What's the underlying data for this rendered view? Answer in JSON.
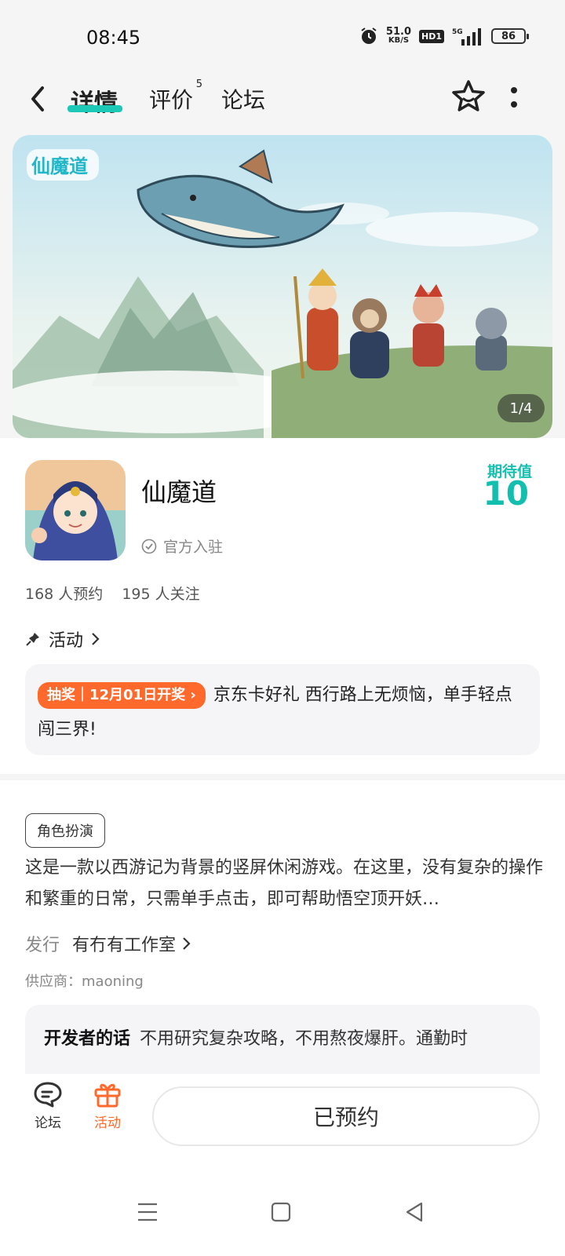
{
  "status": {
    "time": "08:45",
    "speed_value": "51.0",
    "speed_unit": "KB/S",
    "hd": "HD1",
    "network": "5G",
    "battery": "86"
  },
  "nav": {
    "tabs": [
      {
        "label": "详情"
      },
      {
        "label": "评价",
        "badge": "5"
      },
      {
        "label": "论坛"
      }
    ],
    "active_color": "#1ec8b6"
  },
  "banner": {
    "logo_text": "仙魔道",
    "counter": "1/4"
  },
  "app": {
    "name": "仙魔道",
    "official": "官方入驻",
    "expect_label": "期待值",
    "expect_value": "10",
    "stats": [
      "168 人预约",
      "195 人关注"
    ]
  },
  "activity": {
    "title": "活动",
    "tag": "抽奖｜12月01日开奖",
    "text": "京东卡好礼 西行路上无烦恼，单手轻点闯三界!"
  },
  "desc": {
    "genre": "角色扮演",
    "text": "这是一款以西游记为背景的竖屏休闲游戏。在这里，没有复杂的操作和繁重的日常，只需单手点击，即可帮助悟空顶开妖…",
    "publisher_label": "发行",
    "publisher_value": "有冇有工作室",
    "supplier": "供应商：maoning",
    "dev_label": "开发者的话",
    "dev_text": "不用研究复杂攻略，不用熬夜爆肝。通勤时"
  },
  "bottom": {
    "forum": "论坛",
    "activity": "活动",
    "reserve": "已预约"
  },
  "colors": {
    "accent": "#1ec8b6",
    "orange": "#ff6a2c"
  }
}
